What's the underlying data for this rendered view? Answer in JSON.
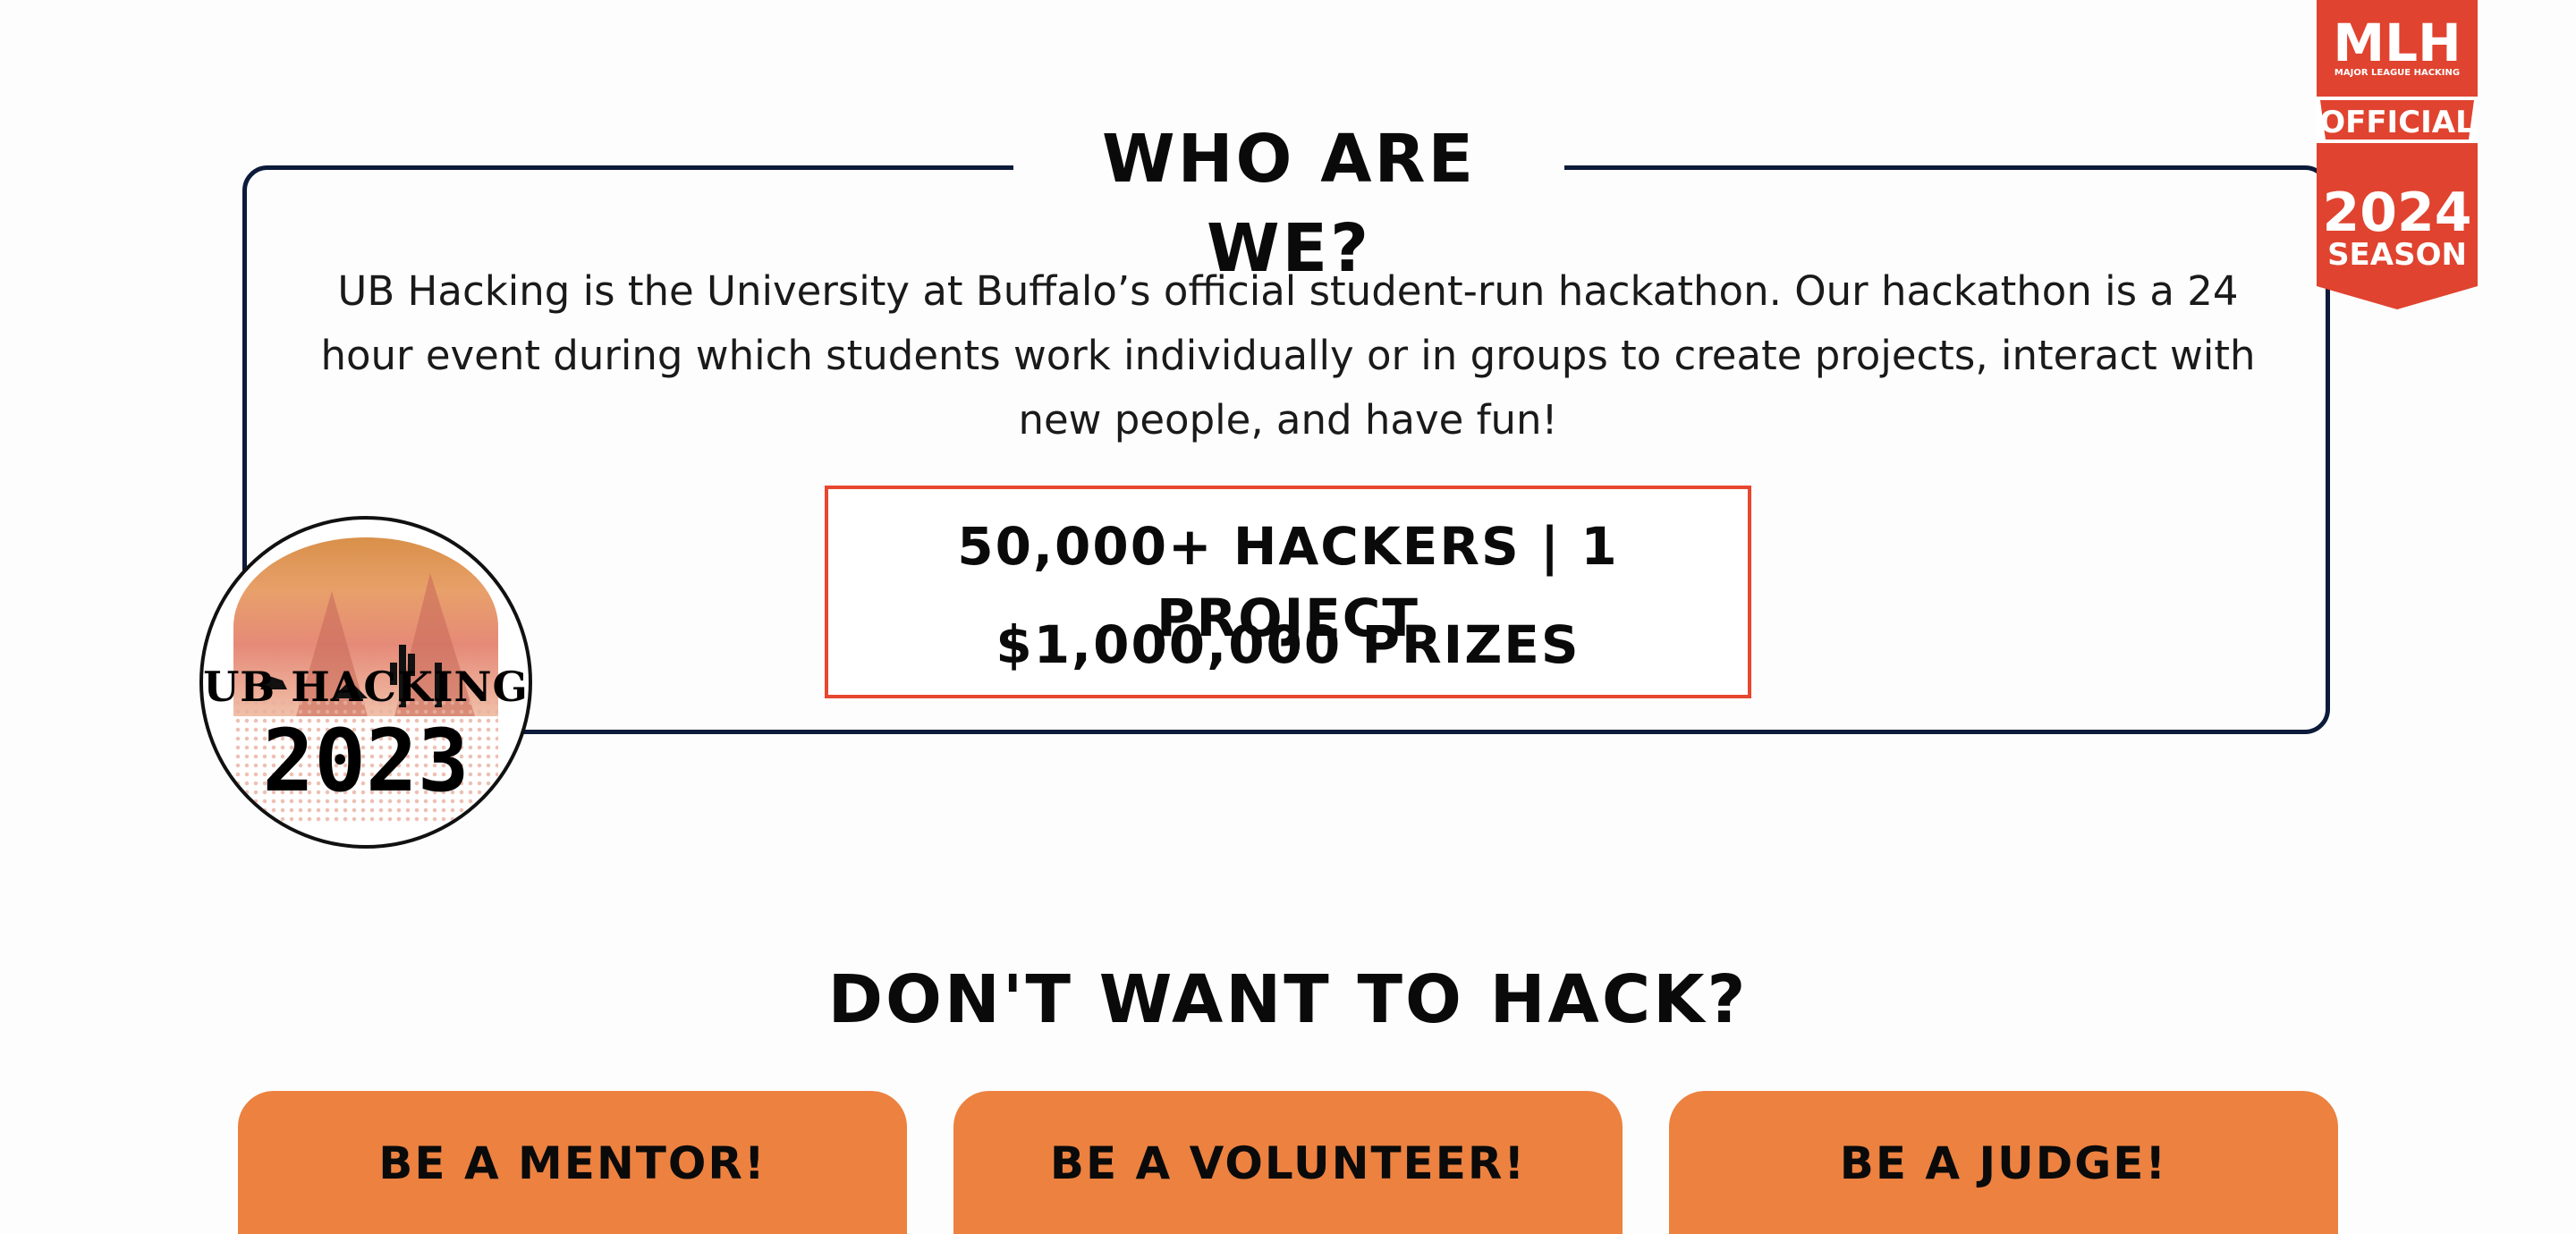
{
  "who": {
    "title": "WHO ARE WE?",
    "description": "UB Hacking is the University at Buffalo’s official student-run hackathon. Our hackathon is a 24 hour event during which students work individually or in groups to create projects, interact with new people, and have fun!",
    "stats_line1": "50,000+ HACKERS | 1 PROJECT",
    "stats_line2": "$1,000,000 PRIZES"
  },
  "logo": {
    "text": "UB HACKING",
    "year": "2023"
  },
  "mlh_badge": {
    "brand": "MLH",
    "subtitle": "MAJOR LEAGUE HACKING",
    "ribbon": "OFFICIAL",
    "year": "2024",
    "season": "SEASON"
  },
  "dont_hack": {
    "title": "DON'T WANT TO HACK?",
    "cards": [
      {
        "label": "BE A MENTOR!"
      },
      {
        "label": "BE A VOLUNTEER!"
      },
      {
        "label": "BE A JUDGE!"
      }
    ]
  },
  "colors": {
    "accent_orange": "#ec8140",
    "stats_border": "#e8462e",
    "mlh_red": "#e0432f",
    "box_border": "#0d1b3a"
  }
}
